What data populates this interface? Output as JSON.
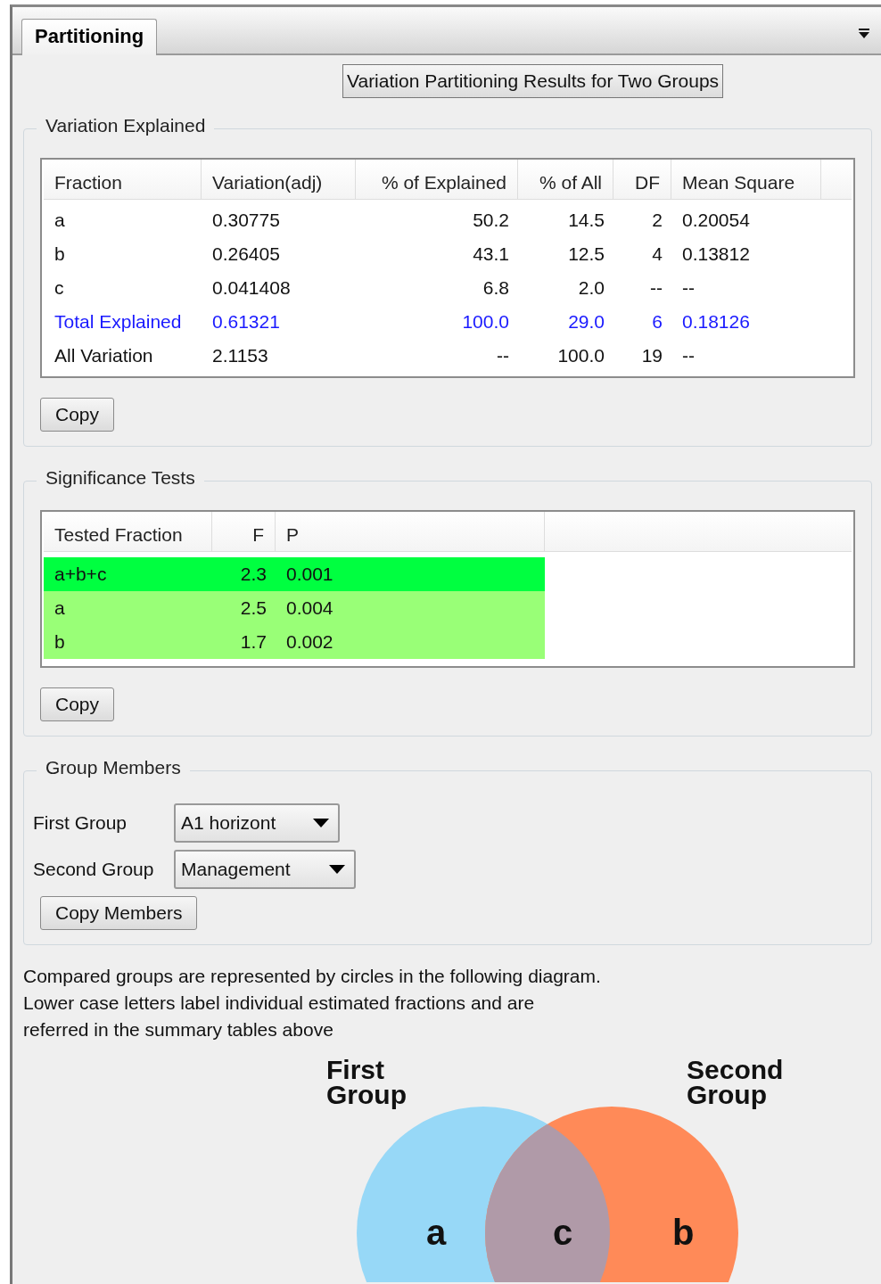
{
  "tabs": [
    {
      "label": "Partitioning",
      "selected": true
    }
  ],
  "header_button": "Variation Partitioning Results for Two Groups",
  "variation_explained": {
    "title": "Variation Explained",
    "columns": [
      "Fraction",
      "Variation(adj)",
      "% of Explained",
      "% of All",
      "DF",
      "Mean Square"
    ],
    "rows": [
      {
        "cells": [
          "a",
          "0.30775",
          "50.2",
          "14.5",
          "2",
          "0.20054"
        ],
        "emphasis": false
      },
      {
        "cells": [
          "b",
          "0.26405",
          "43.1",
          "12.5",
          "4",
          "0.13812"
        ],
        "emphasis": false
      },
      {
        "cells": [
          "c",
          "0.041408",
          "6.8",
          "2.0",
          "--",
          "--"
        ],
        "emphasis": false
      },
      {
        "cells": [
          "Total Explained",
          "0.61321",
          "100.0",
          "29.0",
          "6",
          "0.18126"
        ],
        "emphasis": true
      },
      {
        "cells": [
          "All Variation",
          "2.1153",
          "--",
          "100.0",
          "19",
          "--"
        ],
        "emphasis": false
      }
    ],
    "copy_button": "Copy"
  },
  "significance_tests": {
    "title": "Significance Tests",
    "columns": [
      "Tested Fraction",
      "F",
      "P"
    ],
    "rows": [
      {
        "cells": [
          "a+b+c",
          "2.3",
          "0.001"
        ],
        "selected": true
      },
      {
        "cells": [
          "a",
          "2.5",
          "0.004"
        ],
        "selected": false
      },
      {
        "cells": [
          "b",
          "1.7",
          "0.002"
        ],
        "selected": false
      }
    ],
    "copy_button": "Copy"
  },
  "group_members": {
    "title": "Group Members",
    "fields": [
      {
        "label": "First Group",
        "value": "A1 horizont"
      },
      {
        "label": "Second Group",
        "value": "Management"
      }
    ],
    "copy_button": "Copy Members"
  },
  "description": "Compared groups are represented by circles in the following diagram. Lower case letters label individual estimated fractions and are referred in the summary tables above",
  "diagram": {
    "groups": [
      {
        "label": "First Group",
        "color": "#97d8f7"
      },
      {
        "label": "Second Group",
        "color": "#ff8a58"
      }
    ],
    "fractions": [
      "a",
      "c",
      "b"
    ]
  }
}
